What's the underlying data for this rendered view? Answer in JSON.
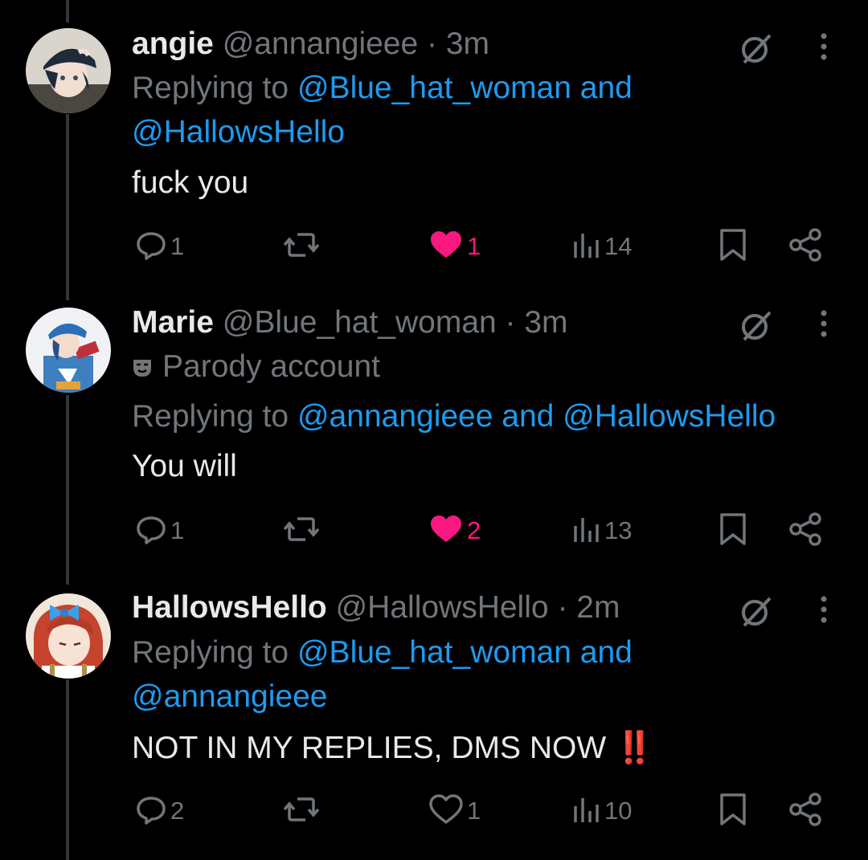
{
  "tweets": [
    {
      "name": "angie",
      "handle": "@annangieee",
      "time": "· 3m",
      "replying_prefix": "Replying to",
      "reply_line1": "@Blue_hat_woman and",
      "reply_line2": "@HallowsHello",
      "text": "fuck you",
      "replies": "1",
      "likes": "1",
      "liked": true,
      "views": "14"
    },
    {
      "name": "Marie",
      "handle": "@Blue_hat_woman",
      "time": "· 3m",
      "badge": "Parody account",
      "replying_prefix": "Replying to",
      "reply_line1": "@annangieee and @HallowsHello",
      "text": "You will",
      "replies": "1",
      "likes": "2",
      "liked": true,
      "views": "13"
    },
    {
      "name": "HallowsHello",
      "handle": "@HallowsHello",
      "time": "· 2m",
      "replying_prefix": "Replying to",
      "reply_line1": "@Blue_hat_woman and",
      "reply_line2": "@annangieee",
      "text": "NOT IN MY REPLIES, DMS NOW ‼️",
      "replies": "2",
      "likes": "1",
      "liked": false,
      "views": "10"
    }
  ],
  "icons": {
    "grok": "grok-icon",
    "more": "more-icon",
    "reply": "reply-icon",
    "repost": "repost-icon",
    "like": "heart-icon",
    "views": "views-icon",
    "bookmark": "bookmark-icon",
    "share": "share-icon",
    "parody": "parody-mask-icon"
  },
  "colors": {
    "background": "#000000",
    "text": "#e7e9ea",
    "muted": "#71767b",
    "link": "#1d9bf0",
    "like": "#f91880"
  }
}
